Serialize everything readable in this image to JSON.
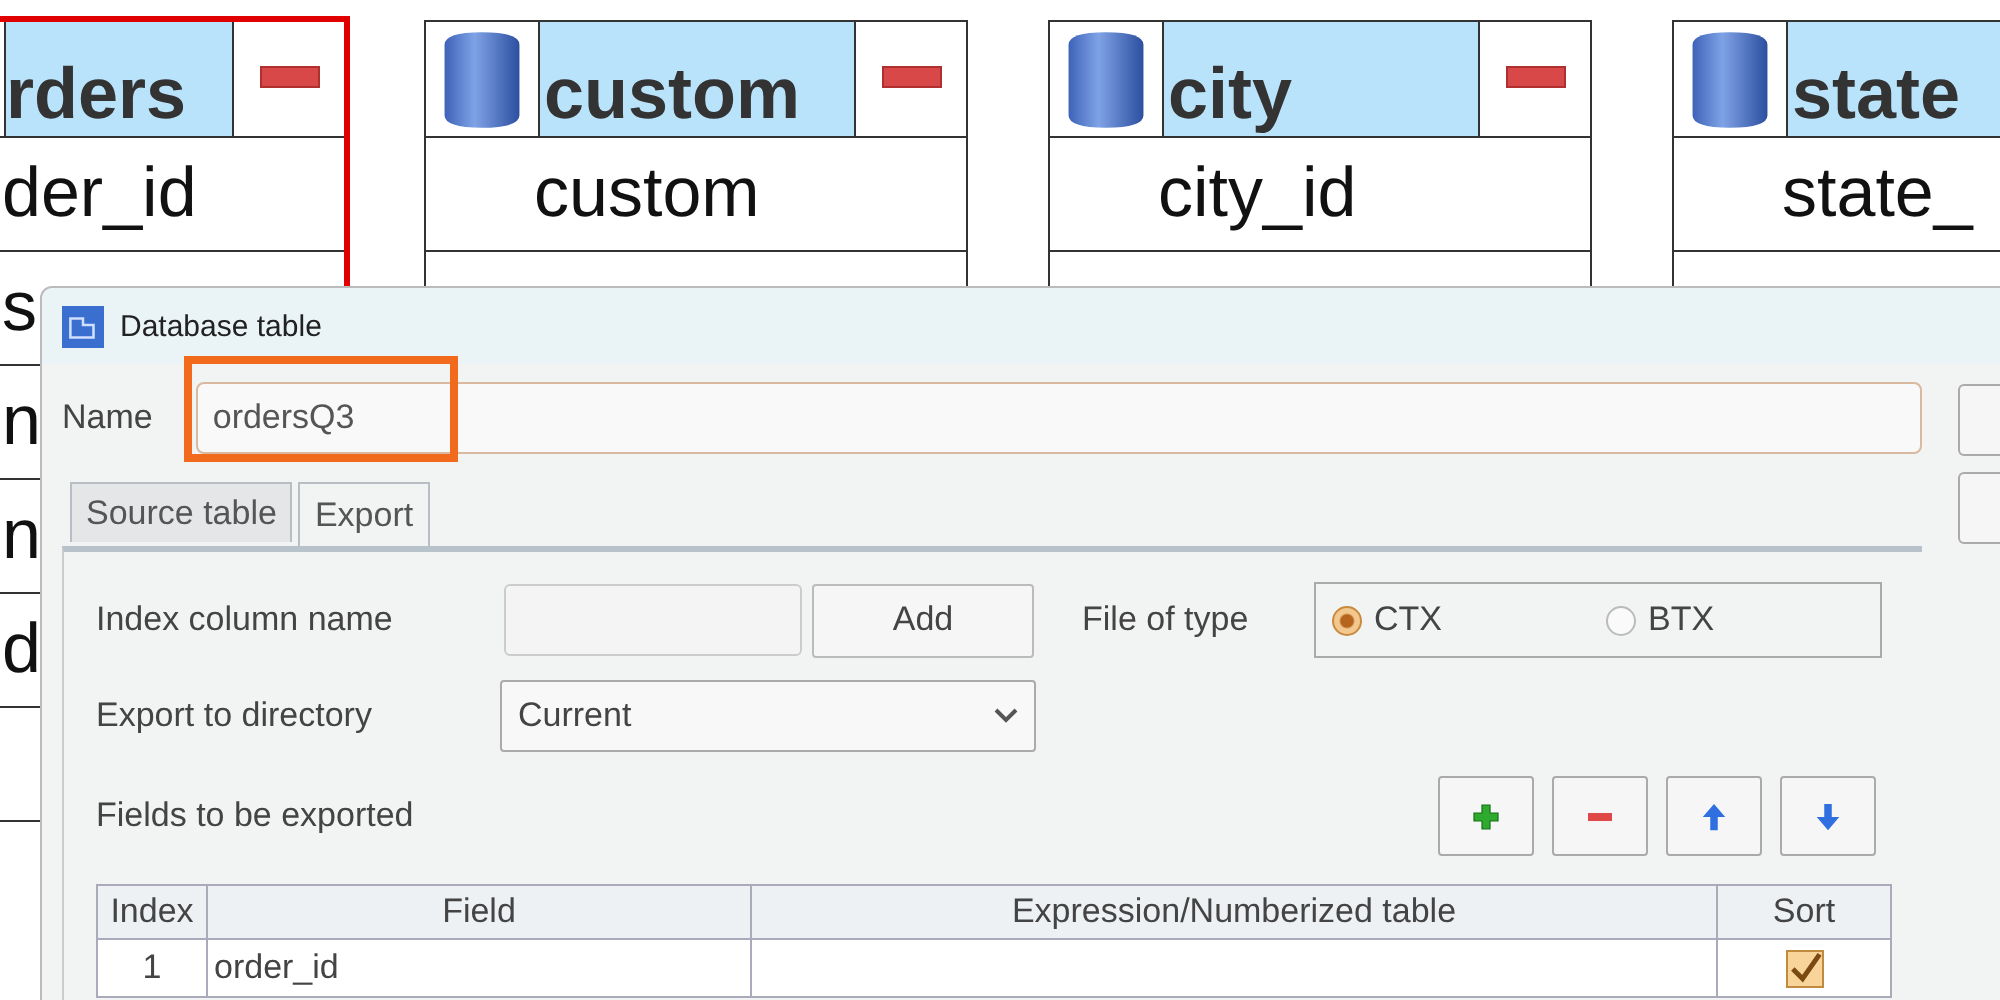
{
  "canvas_nodes": [
    {
      "title": "rders",
      "selected": true,
      "fields": [
        "der_id",
        "s",
        "n",
        "n",
        "d"
      ]
    },
    {
      "title": "custom",
      "selected": false,
      "fields": [
        "custom"
      ]
    },
    {
      "title": "city",
      "selected": false,
      "fields": [
        "city_id"
      ]
    },
    {
      "title": "state",
      "selected": false,
      "fields": [
        "state_"
      ]
    }
  ],
  "dialog": {
    "title": "Database table",
    "name_label": "Name",
    "name_value": "ordersQ3",
    "tabs": [
      {
        "label": "Source table",
        "selected": false
      },
      {
        "label": "Export",
        "selected": true
      }
    ],
    "index_column": {
      "label": "Index column name",
      "button": "Add"
    },
    "file_type": {
      "label": "File of type",
      "options": [
        {
          "label": "CTX",
          "selected": true
        },
        {
          "label": "BTX",
          "selected": false
        }
      ]
    },
    "export_dir": {
      "label": "Export to directory",
      "value": "Current"
    },
    "fields_label": "Fields to be exported",
    "field_buttons": [
      {
        "kind": "add"
      },
      {
        "kind": "remove"
      },
      {
        "kind": "up"
      },
      {
        "kind": "down"
      }
    ],
    "table": {
      "columns": [
        "Index",
        "Field",
        "Expression/Numberized table",
        "Sort"
      ],
      "rows": [
        {
          "index": "1",
          "field": "order_id",
          "sort": true
        }
      ]
    }
  }
}
